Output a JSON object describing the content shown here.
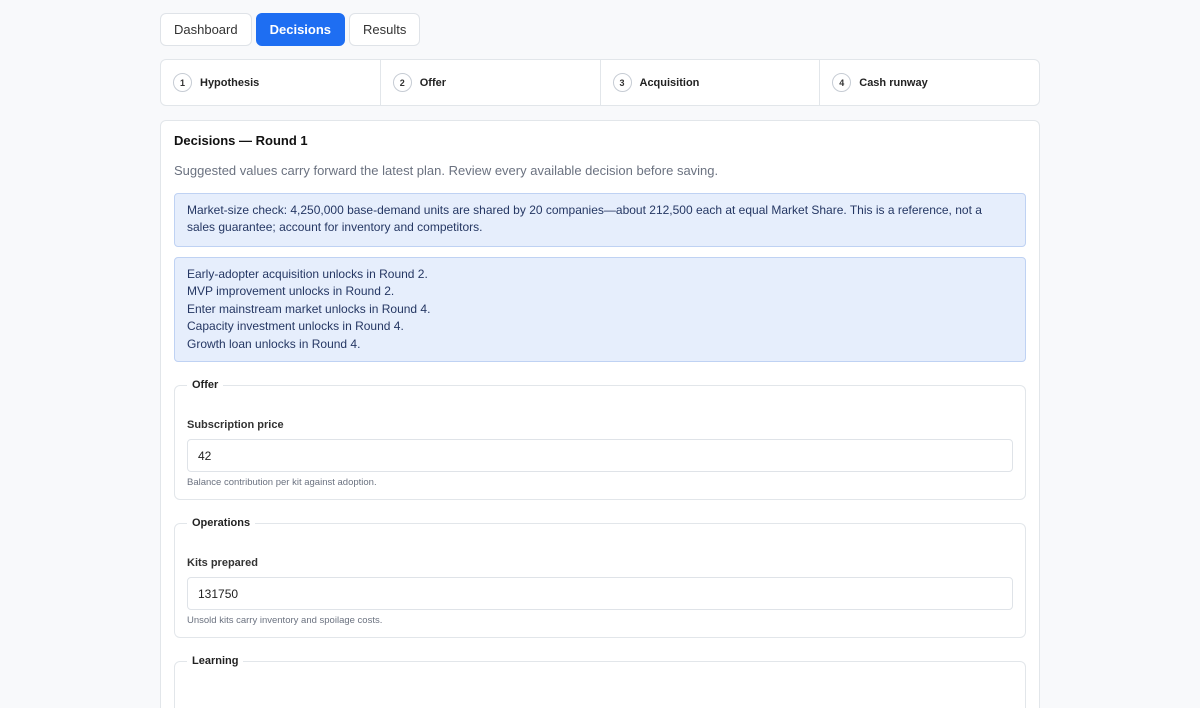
{
  "tabs": [
    {
      "label": "Dashboard",
      "active": false
    },
    {
      "label": "Decisions",
      "active": true
    },
    {
      "label": "Results",
      "active": false
    }
  ],
  "steps": [
    {
      "num": "1",
      "label": "Hypothesis"
    },
    {
      "num": "2",
      "label": "Offer"
    },
    {
      "num": "3",
      "label": "Acquisition"
    },
    {
      "num": "4",
      "label": "Cash runway"
    }
  ],
  "panel": {
    "title": "Decisions — Round 1",
    "subtitle": "Suggested values carry forward the latest plan. Review every available decision before saving.",
    "market_notice": "Market-size check: 4,250,000 base-demand units are shared by 20 companies—about 212,500 each at equal Market Share. This is a reference, not a sales guarantee; account for inventory and competitors.",
    "unlocks": [
      "Early-adopter acquisition unlocks in Round 2.",
      "MVP improvement unlocks in Round 2.",
      "Enter mainstream market unlocks in Round 4.",
      "Capacity investment unlocks in Round 4.",
      "Growth loan unlocks in Round 4."
    ]
  },
  "offer": {
    "legend": "Offer",
    "label": "Subscription price",
    "value": "42",
    "help": "Balance contribution per kit against adoption."
  },
  "operations": {
    "legend": "Operations",
    "label": "Kits prepared",
    "value": "131750",
    "help": "Unsold kits carry inventory and spoilage costs."
  },
  "learning": {
    "legend": "Learning"
  }
}
